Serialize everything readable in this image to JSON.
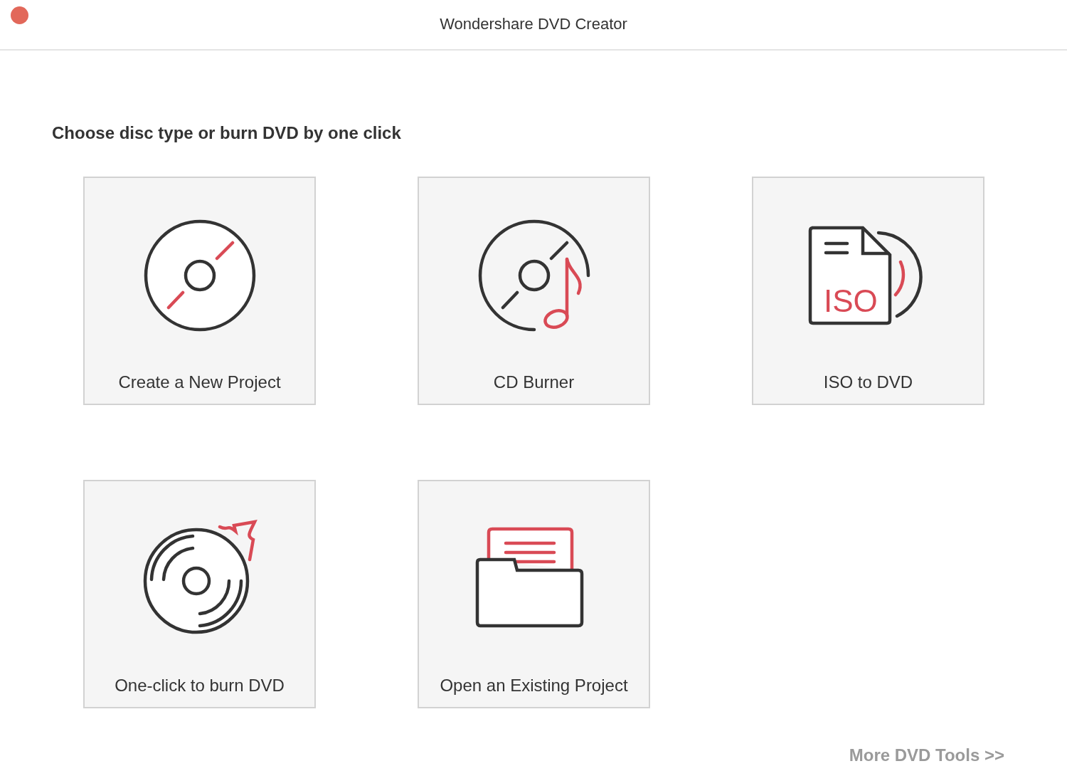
{
  "window": {
    "title": "Wondershare DVD Creator"
  },
  "heading": "Choose disc type or burn DVD by one click",
  "tiles": [
    {
      "kind": "disc",
      "label": "Create a New Project"
    },
    {
      "kind": "music",
      "label": "CD Burner"
    },
    {
      "kind": "iso",
      "label": "ISO to DVD",
      "icon_text": "ISO"
    },
    {
      "kind": "burn",
      "label": "One-click to burn DVD"
    },
    {
      "kind": "folder",
      "label": "Open an Existing Project"
    }
  ],
  "more_link": "More DVD Tools >>"
}
